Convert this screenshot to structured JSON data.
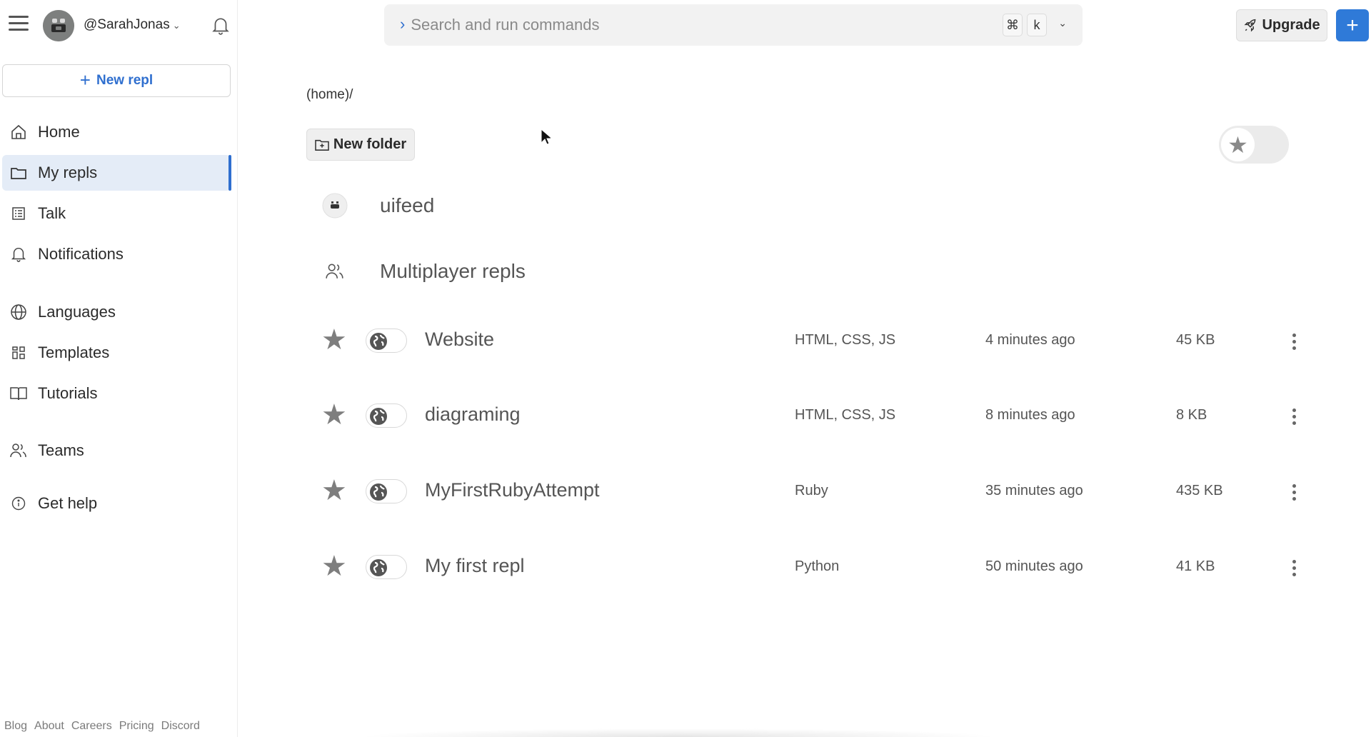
{
  "user": {
    "username": "@SarahJonas"
  },
  "sidebar": {
    "new_repl_label": "New repl",
    "items": [
      {
        "label": "Home",
        "icon": "home-icon"
      },
      {
        "label": "My repls",
        "icon": "folder-icon",
        "active": true
      },
      {
        "label": "Talk",
        "icon": "list-icon"
      },
      {
        "label": "Notifications",
        "icon": "bell-icon"
      },
      {
        "label": "Languages",
        "icon": "globe-icon"
      },
      {
        "label": "Templates",
        "icon": "grid-icon"
      },
      {
        "label": "Tutorials",
        "icon": "book-icon"
      },
      {
        "label": "Teams",
        "icon": "users-icon"
      },
      {
        "label": "Get help",
        "icon": "info-icon"
      }
    ],
    "footer_links": [
      "Blog",
      "About",
      "Careers",
      "Pricing",
      "Discord"
    ]
  },
  "topbar": {
    "search_placeholder": "Search and run commands",
    "shortcut_keys": [
      "⌘",
      "k"
    ],
    "upgrade_label": "Upgrade"
  },
  "main": {
    "breadcrumb": "(home)/",
    "new_folder_label": "New folder",
    "favorites_toggle": false,
    "folders": [
      {
        "name": "uifeed",
        "icon": "team-avatar-icon"
      },
      {
        "name": "Multiplayer repls",
        "icon": "users-icon"
      }
    ],
    "repls": [
      {
        "title": "Website",
        "languages": "HTML, CSS, JS",
        "updated": "4 minutes ago",
        "size": "45 KB",
        "starred": false,
        "public": true
      },
      {
        "title": "diagraming",
        "languages": "HTML, CSS, JS",
        "updated": "8 minutes ago",
        "size": "8 KB",
        "starred": false,
        "public": true
      },
      {
        "title": "MyFirstRubyAttempt",
        "languages": "Ruby",
        "updated": "35 minutes ago",
        "size": "435 KB",
        "starred": false,
        "public": true
      },
      {
        "title": "My first repl",
        "languages": "Python",
        "updated": "50 minutes ago",
        "size": "41 KB",
        "starred": false,
        "public": true
      }
    ]
  },
  "colors": {
    "accent": "#2f6fcf",
    "active_nav_bg": "#e4ecf7",
    "plus_button": "#2f7ad8"
  }
}
